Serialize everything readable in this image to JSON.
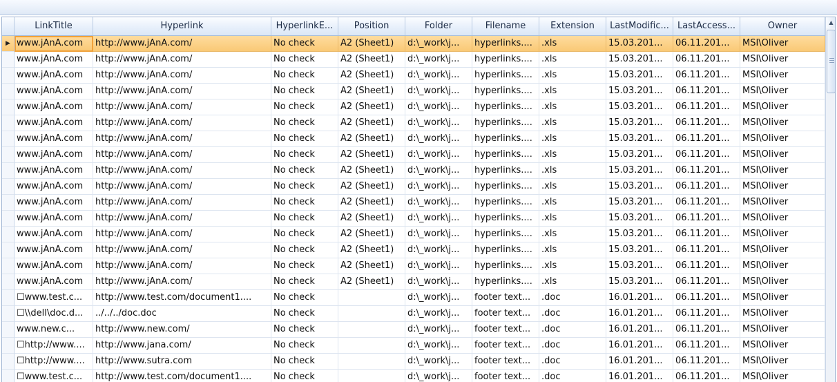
{
  "columns": [
    {
      "key": "title",
      "label": "LinkTitle"
    },
    {
      "key": "hyperlink",
      "label": "Hyperlink"
    },
    {
      "key": "hyperlink_exists",
      "label": "HyperlinkE..."
    },
    {
      "key": "position",
      "label": "Position"
    },
    {
      "key": "folder",
      "label": "Folder"
    },
    {
      "key": "filename",
      "label": "Filename"
    },
    {
      "key": "extension",
      "label": "Extension"
    },
    {
      "key": "last_modified",
      "label": "LastModific..."
    },
    {
      "key": "last_accessed",
      "label": "LastAccess..."
    },
    {
      "key": "owner",
      "label": "Owner"
    }
  ],
  "selected_row_index": 0,
  "row_indicator_icon": "current-row-arrow-icon",
  "rows": [
    [
      "www.jAnA.com",
      "http://www.jAnA.com/",
      "No check",
      "A2 (Sheet1)",
      "d:\\_work\\j...",
      "hyperlinks....",
      ".xls",
      "15.03.201...",
      "06.11.201...",
      "MSI\\Oliver"
    ],
    [
      "www.jAnA.com",
      "http://www.jAnA.com/",
      "No check",
      "A2 (Sheet1)",
      "d:\\_work\\j...",
      "hyperlinks....",
      ".xls",
      "15.03.201...",
      "06.11.201...",
      "MSI\\Oliver"
    ],
    [
      "www.jAnA.com",
      "http://www.jAnA.com/",
      "No check",
      "A2 (Sheet1)",
      "d:\\_work\\j...",
      "hyperlinks....",
      ".xls",
      "15.03.201...",
      "06.11.201...",
      "MSI\\Oliver"
    ],
    [
      "www.jAnA.com",
      "http://www.jAnA.com/",
      "No check",
      "A2 (Sheet1)",
      "d:\\_work\\j...",
      "hyperlinks....",
      ".xls",
      "15.03.201...",
      "06.11.201...",
      "MSI\\Oliver"
    ],
    [
      "www.jAnA.com",
      "http://www.jAnA.com/",
      "No check",
      "A2 (Sheet1)",
      "d:\\_work\\j...",
      "hyperlinks....",
      ".xls",
      "15.03.201...",
      "06.11.201...",
      "MSI\\Oliver"
    ],
    [
      "www.jAnA.com",
      "http://www.jAnA.com/",
      "No check",
      "A2 (Sheet1)",
      "d:\\_work\\j...",
      "hyperlinks....",
      ".xls",
      "15.03.201...",
      "06.11.201...",
      "MSI\\Oliver"
    ],
    [
      "www.jAnA.com",
      "http://www.jAnA.com/",
      "No check",
      "A2 (Sheet1)",
      "d:\\_work\\j...",
      "hyperlinks....",
      ".xls",
      "15.03.201...",
      "06.11.201...",
      "MSI\\Oliver"
    ],
    [
      "www.jAnA.com",
      "http://www.jAnA.com/",
      "No check",
      "A2 (Sheet1)",
      "d:\\_work\\j...",
      "hyperlinks....",
      ".xls",
      "15.03.201...",
      "06.11.201...",
      "MSI\\Oliver"
    ],
    [
      "www.jAnA.com",
      "http://www.jAnA.com/",
      "No check",
      "A2 (Sheet1)",
      "d:\\_work\\j...",
      "hyperlinks....",
      ".xls",
      "15.03.201...",
      "06.11.201...",
      "MSI\\Oliver"
    ],
    [
      "www.jAnA.com",
      "http://www.jAnA.com/",
      "No check",
      "A2 (Sheet1)",
      "d:\\_work\\j...",
      "hyperlinks....",
      ".xls",
      "15.03.201...",
      "06.11.201...",
      "MSI\\Oliver"
    ],
    [
      "www.jAnA.com",
      "http://www.jAnA.com/",
      "No check",
      "A2 (Sheet1)",
      "d:\\_work\\j...",
      "hyperlinks....",
      ".xls",
      "15.03.201...",
      "06.11.201...",
      "MSI\\Oliver"
    ],
    [
      "www.jAnA.com",
      "http://www.jAnA.com/",
      "No check",
      "A2 (Sheet1)",
      "d:\\_work\\j...",
      "hyperlinks....",
      ".xls",
      "15.03.201...",
      "06.11.201...",
      "MSI\\Oliver"
    ],
    [
      "www.jAnA.com",
      "http://www.jAnA.com/",
      "No check",
      "A2 (Sheet1)",
      "d:\\_work\\j...",
      "hyperlinks....",
      ".xls",
      "15.03.201...",
      "06.11.201...",
      "MSI\\Oliver"
    ],
    [
      "www.jAnA.com",
      "http://www.jAnA.com/",
      "No check",
      "A2 (Sheet1)",
      "d:\\_work\\j...",
      "hyperlinks....",
      ".xls",
      "15.03.201...",
      "06.11.201...",
      "MSI\\Oliver"
    ],
    [
      "www.jAnA.com",
      "http://www.jAnA.com/",
      "No check",
      "A2 (Sheet1)",
      "d:\\_work\\j...",
      "hyperlinks....",
      ".xls",
      "15.03.201...",
      "06.11.201...",
      "MSI\\Oliver"
    ],
    [
      "www.jAnA.com",
      "http://www.jAnA.com/",
      "No check",
      "A2 (Sheet1)",
      "d:\\_work\\j...",
      "hyperlinks....",
      ".xls",
      "15.03.201...",
      "06.11.201...",
      "MSI\\Oliver"
    ],
    [
      "☐www.test.c...",
      "http://www.test.com/document1....",
      "No check",
      "",
      "d:\\_work\\j...",
      "footer text...",
      ".doc",
      "16.01.201...",
      "06.11.201...",
      "MSI\\Oliver"
    ],
    [
      "☐\\\\dell\\doc.d...",
      "../../../doc.doc",
      "No check",
      "",
      "d:\\_work\\j...",
      "footer text...",
      ".doc",
      "16.01.201...",
      "06.11.201...",
      "MSI\\Oliver"
    ],
    [
      "www.new.c...",
      "http://www.new.com/",
      "No check",
      "",
      "d:\\_work\\j...",
      "footer text...",
      ".doc",
      "16.01.201...",
      "06.11.201...",
      "MSI\\Oliver"
    ],
    [
      "☐http://www....",
      "http://www.jana.com/",
      "No check",
      "",
      "d:\\_work\\j...",
      "footer text...",
      ".doc",
      "16.01.201...",
      "06.11.201...",
      "MSI\\Oliver"
    ],
    [
      "☐http://www....",
      "http://www.sutra.com",
      "No check",
      "",
      "d:\\_work\\j...",
      "footer text...",
      ".doc",
      "16.01.201...",
      "06.11.201...",
      "MSI\\Oliver"
    ],
    [
      "☐www.test.c...",
      "http://www.test.com/document1....",
      "No check",
      "",
      "d:\\_work\\j...",
      "footer text...",
      ".doc",
      "16.01.201...",
      "06.11.201...",
      "MSI\\Oliver"
    ]
  ]
}
